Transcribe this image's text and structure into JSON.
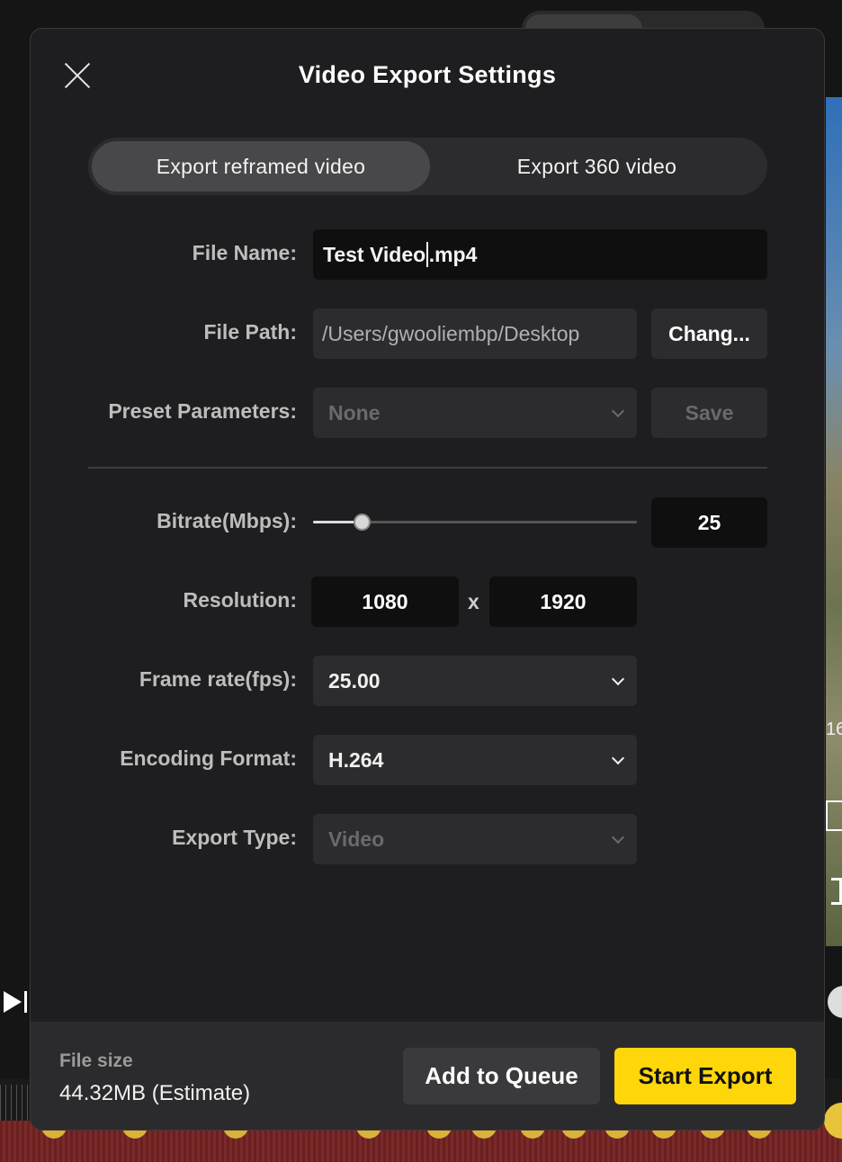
{
  "dialog": {
    "title": "Video Export Settings",
    "tabs": [
      {
        "label": "Export reframed video",
        "active": true
      },
      {
        "label": "Export 360 video",
        "active": false
      }
    ]
  },
  "form": {
    "file_name": {
      "label": "File Name:",
      "base": "Test Video",
      "ext": ".mp4"
    },
    "file_path": {
      "label": "File Path:",
      "value": "/Users/gwooliembp/Desktop",
      "button": "Chang..."
    },
    "preset": {
      "label": "Preset Parameters:",
      "value": "None",
      "button": "Save"
    },
    "bitrate": {
      "label": "Bitrate(Mbps):",
      "value": "25",
      "slider_fraction": 0.15
    },
    "resolution": {
      "label": "Resolution:",
      "width": "1080",
      "separator": "x",
      "height": "1920"
    },
    "frame_rate": {
      "label": "Frame rate(fps):",
      "value": "25.00"
    },
    "encoding": {
      "label": "Encoding Format:",
      "value": "H.264"
    },
    "export_type": {
      "label": "Export Type:",
      "value": "Video"
    }
  },
  "footer": {
    "file_size_label": "File size",
    "file_size_value": "44.32MB (Estimate)",
    "queue_button": "Add to Queue",
    "export_button": "Start Export"
  },
  "background": {
    "side_text": "16"
  },
  "colors": {
    "accent": "#ffd60a",
    "dialog_bg": "#1e1e20",
    "field_dark": "#0f0f10",
    "field_mid": "#2c2c2e"
  }
}
